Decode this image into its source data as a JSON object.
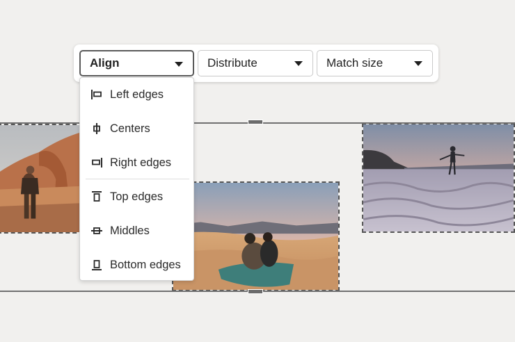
{
  "toolbar": {
    "align_label": "Align",
    "distribute_label": "Distribute",
    "match_size_label": "Match size"
  },
  "align_menu": {
    "items": [
      {
        "label": "Left edges",
        "icon": "align-left-edges-icon"
      },
      {
        "label": "Centers",
        "icon": "align-centers-icon"
      },
      {
        "label": "Right edges",
        "icon": "align-right-edges-icon"
      },
      {
        "label": "Top edges",
        "icon": "align-top-edges-icon"
      },
      {
        "label": "Middles",
        "icon": "align-middles-icon"
      },
      {
        "label": "Bottom edges",
        "icon": "align-bottom-edges-icon"
      }
    ]
  },
  "colors": {
    "background": "#f1f0ee",
    "selection_border": "#555555",
    "menu_background": "#ffffff"
  }
}
